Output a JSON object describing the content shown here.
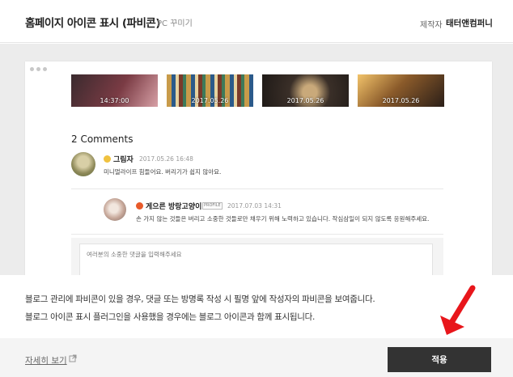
{
  "header": {
    "title": "홈페이지 아이콘 표시 (파비콘)",
    "subtitle": "PC 꾸미기",
    "maker_label": "제작자",
    "maker_name": "태터앤컴퍼니"
  },
  "preview": {
    "thumbnails": [
      {
        "date": "14:37:00"
      },
      {
        "date": "2017.05.26"
      },
      {
        "date": "2017.05.26"
      },
      {
        "date": "2017.05.26"
      }
    ],
    "comments_title": "2 Comments",
    "comments": [
      {
        "author": "그림자",
        "date": "2017.05.26 16:48",
        "text": "미니멀라이프 힘들어요. 버리기가 쉽지 않아요."
      },
      {
        "author": "게으른 방랑고양이",
        "tag": "PROFILE",
        "date": "2017.07.03 14:31",
        "text": "손 가지 않는 것들은 버리고 소중한 것들로만 채우기 위해 노력하고 있습니다. 작심삼일이 되지 않도록 응원해주세요."
      }
    ],
    "input_placeholder": "여러분의 소중한 댓글을 입력해주세요"
  },
  "description": {
    "line1": "블로그 관리에 파비콘이 있을 경우, 댓글 또는 방명록 작성 시 필명 앞에 작성자의 파비콘을 보여줍니다.",
    "line2": "블로그 아이콘 표시 플러그인을 사용했을 경우에는 블로그 아이콘과 함께 표시됩니다."
  },
  "footer": {
    "more_link": "자세히 보기",
    "apply_button": "적용"
  },
  "colors": {
    "accent_arrow": "#e8161b",
    "button_bg": "#333333"
  }
}
